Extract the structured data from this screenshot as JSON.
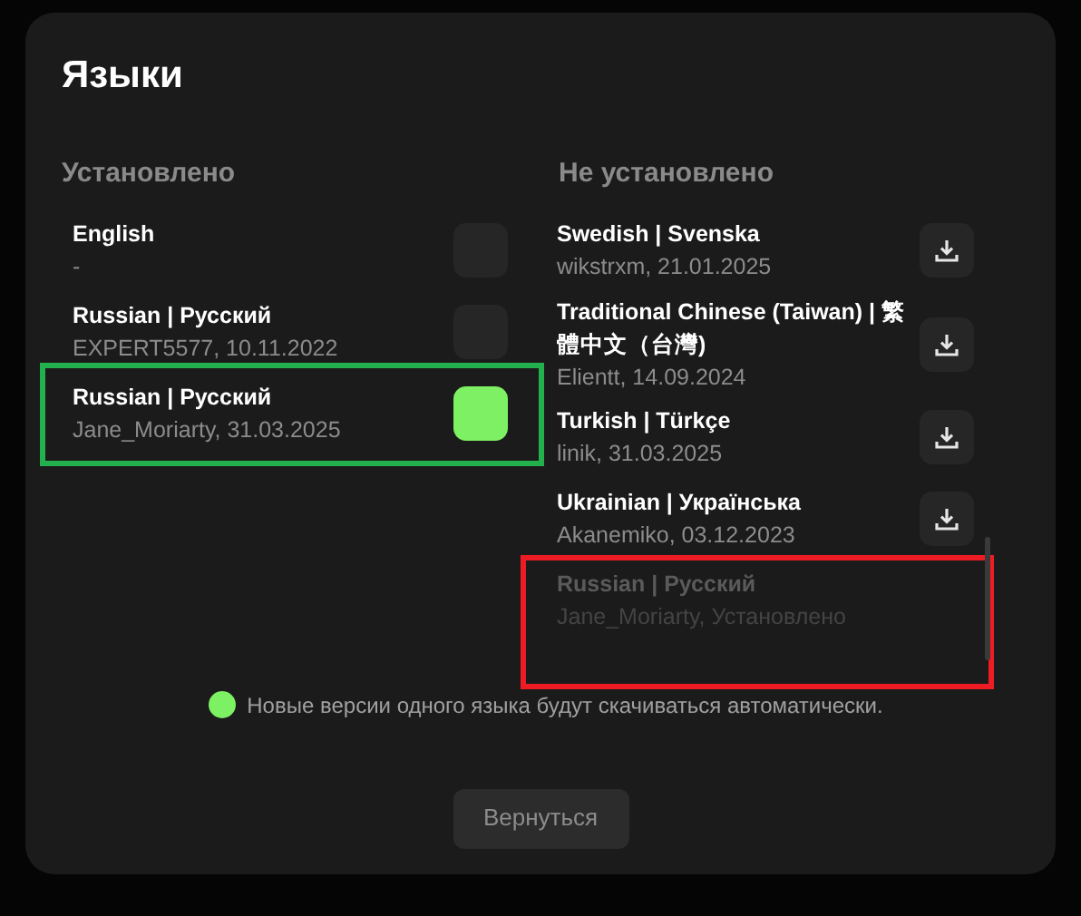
{
  "dialog": {
    "title": "Языки"
  },
  "installed": {
    "heading": "Установлено",
    "items": [
      {
        "name": "English",
        "detail": "-",
        "on": false
      },
      {
        "name": "Russian | Русский",
        "detail": "EXPERT5577, 10.11.2022",
        "on": false
      },
      {
        "name": "Russian | Русский",
        "detail": "Jane_Moriarty, 31.03.2025",
        "on": true,
        "color": "#22b14c"
      }
    ]
  },
  "available": {
    "heading": "Не установлено",
    "items": [
      {
        "name": "Swedish | Svenska",
        "detail": "wikstrxm, 21.01.2025",
        "disabled": false
      },
      {
        "name": "Traditional Chinese (Taiwan) | 繁體中文（台灣)",
        "detail": "Elientt, 14.09.2024",
        "disabled": false
      },
      {
        "name": "Turkish | Türkçe",
        "detail": "linik, 31.03.2025",
        "disabled": false
      },
      {
        "name": "Ukrainian | Українська",
        "detail": "Akanemiko, 03.12.2023",
        "disabled": false
      },
      {
        "name": "Russian | Русский",
        "detail": "Jane_Moriarty, Установлено",
        "disabled": true,
        "color": "#ed1c24"
      }
    ]
  },
  "note": "Новые версии одного языка будут скачиваться автоматически.",
  "back_button": "Вернуться"
}
